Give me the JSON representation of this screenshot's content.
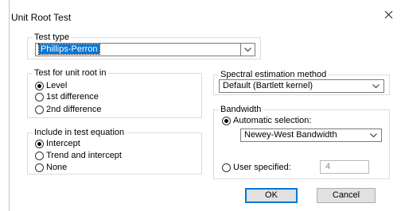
{
  "window": {
    "title": "Unit Root Test"
  },
  "test_type": {
    "legend": "Test type",
    "selected": "Phillips-Perron"
  },
  "unit_root_in": {
    "legend": "Test for unit root in",
    "options": [
      {
        "label": "Level",
        "selected": true
      },
      {
        "label": "1st difference",
        "selected": false
      },
      {
        "label": "2nd difference",
        "selected": false
      }
    ]
  },
  "include": {
    "legend": "Include in test equation",
    "options": [
      {
        "label": "Intercept",
        "selected": true
      },
      {
        "label": "Trend and intercept",
        "selected": false
      },
      {
        "label": "None",
        "selected": false
      }
    ]
  },
  "spectral": {
    "legend": "Spectral estimation method",
    "selected": "Default  (Bartlett kernel)"
  },
  "bandwidth": {
    "legend": "Bandwidth",
    "automatic_label": "Automatic selection:",
    "automatic_selected": true,
    "automatic_method": "Newey-West Bandwidth",
    "user_label": "User specified:",
    "user_value": "4"
  },
  "buttons": {
    "ok": "OK",
    "cancel": "Cancel"
  },
  "icons": {
    "close": "close-icon",
    "dropdown": "chevron-down-icon"
  }
}
